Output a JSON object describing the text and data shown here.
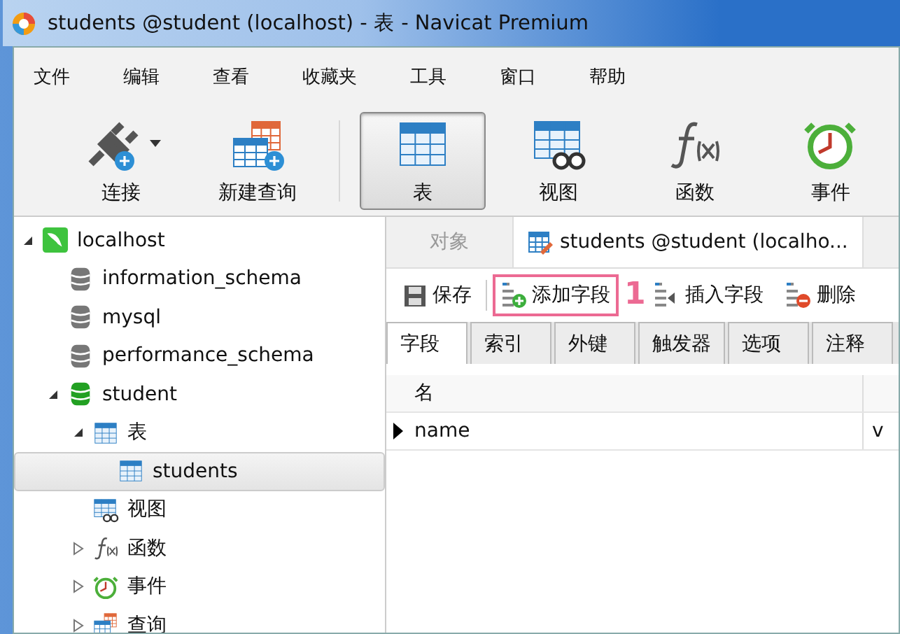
{
  "window": {
    "title": "students @student (localhost) - 表 - Navicat Premium"
  },
  "menu": [
    "文件",
    "编辑",
    "查看",
    "收藏夹",
    "工具",
    "窗口",
    "帮助"
  ],
  "toolbar": [
    {
      "label": "连接",
      "kind": "plug",
      "dropdown": true,
      "selected": false
    },
    {
      "label": "新建查询",
      "kind": "newquery",
      "dropdown": false,
      "selected": false
    },
    {
      "label": "表",
      "kind": "table",
      "dropdown": false,
      "selected": true
    },
    {
      "label": "视图",
      "kind": "view",
      "dropdown": false,
      "selected": false
    },
    {
      "label": "函数",
      "kind": "function",
      "dropdown": false,
      "selected": false
    },
    {
      "label": "事件",
      "kind": "event",
      "dropdown": false,
      "selected": false
    }
  ],
  "tree": [
    {
      "label": "localhost",
      "kind": "server",
      "expandable": true,
      "expanded": true,
      "selected": false,
      "children": [
        {
          "label": "information_schema",
          "kind": "db",
          "expandable": false,
          "selected": false
        },
        {
          "label": "mysql",
          "kind": "db",
          "expandable": false,
          "selected": false
        },
        {
          "label": "performance_schema",
          "kind": "db",
          "expandable": false,
          "selected": false
        },
        {
          "label": "student",
          "kind": "db-open",
          "expandable": true,
          "expanded": true,
          "selected": false,
          "children": [
            {
              "label": "表",
              "kind": "table",
              "expandable": true,
              "expanded": true,
              "selected": false,
              "children": [
                {
                  "label": "students",
                  "kind": "table",
                  "expandable": false,
                  "selected": true
                }
              ]
            },
            {
              "label": "视图",
              "kind": "view",
              "expandable": false,
              "selected": false
            },
            {
              "label": "函数",
              "kind": "function",
              "expandable": true,
              "expanded": false,
              "selected": false
            },
            {
              "label": "事件",
              "kind": "event",
              "expandable": true,
              "expanded": false,
              "selected": false
            },
            {
              "label": "查询",
              "kind": "query",
              "expandable": true,
              "expanded": false,
              "selected": false
            }
          ]
        }
      ]
    }
  ],
  "object_tabs": [
    {
      "label": "对象",
      "selected": false,
      "icon": false
    },
    {
      "label": "students @student (localho...",
      "selected": true,
      "icon": true
    }
  ],
  "actions": [
    {
      "label": "保存",
      "kind": "save",
      "highlighted": false
    },
    {
      "label": "添加字段",
      "kind": "add",
      "highlighted": true
    },
    {
      "label": "插入字段",
      "kind": "insert",
      "highlighted": false
    },
    {
      "label": "删除",
      "kind": "delete",
      "highlighted": false
    }
  ],
  "annotation": "1",
  "sub_tabs": [
    {
      "label": "字段",
      "selected": true
    },
    {
      "label": "索引",
      "selected": false
    },
    {
      "label": "外键",
      "selected": false
    },
    {
      "label": "触发器",
      "selected": false
    },
    {
      "label": "选项",
      "selected": false
    },
    {
      "label": "注释",
      "selected": false
    }
  ],
  "table": {
    "columns": [
      "名"
    ],
    "rows": [
      {
        "cells": [
          "name",
          "v"
        ],
        "current": true
      }
    ]
  }
}
